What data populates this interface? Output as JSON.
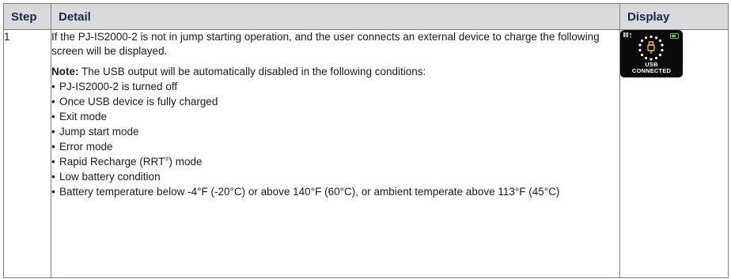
{
  "table": {
    "headers": {
      "step": "Step",
      "detail": "Detail",
      "display": "Display"
    },
    "row": {
      "step": "1",
      "intro": "If the PJ-IS2000-2 is not in jump starting operation, and the user connects an external device to charge the following screen will be displayed.",
      "note_label": "Note:",
      "note_text": " The USB output will be automatically disabled in the following conditions:",
      "conditions": [
        "PJ-IS2000-2 is turned off",
        "Once USB device is fully charged",
        "Exit mode",
        "Jump start mode",
        "Error mode",
        "Low battery condition",
        "Battery temperature below -4°F (-20°C) or above 140°F (60°C), or ambient temperate above 113°F (45°C)"
      ],
      "rapid_recharge": {
        "before": "Rapid Recharge (RRT",
        "sup": "®",
        "after": ") mode"
      },
      "display": {
        "line1": "USB",
        "line2": "CONNECTED"
      }
    }
  },
  "colors": {
    "header_bg": "#d9dadb",
    "header_text": "#1c2a48",
    "usb_icon": "#f2c230",
    "battery": "#3fcf4d"
  },
  "icons": {
    "usb": "usb-plug-icon",
    "battery": "battery-icon",
    "status": "status-icon"
  }
}
